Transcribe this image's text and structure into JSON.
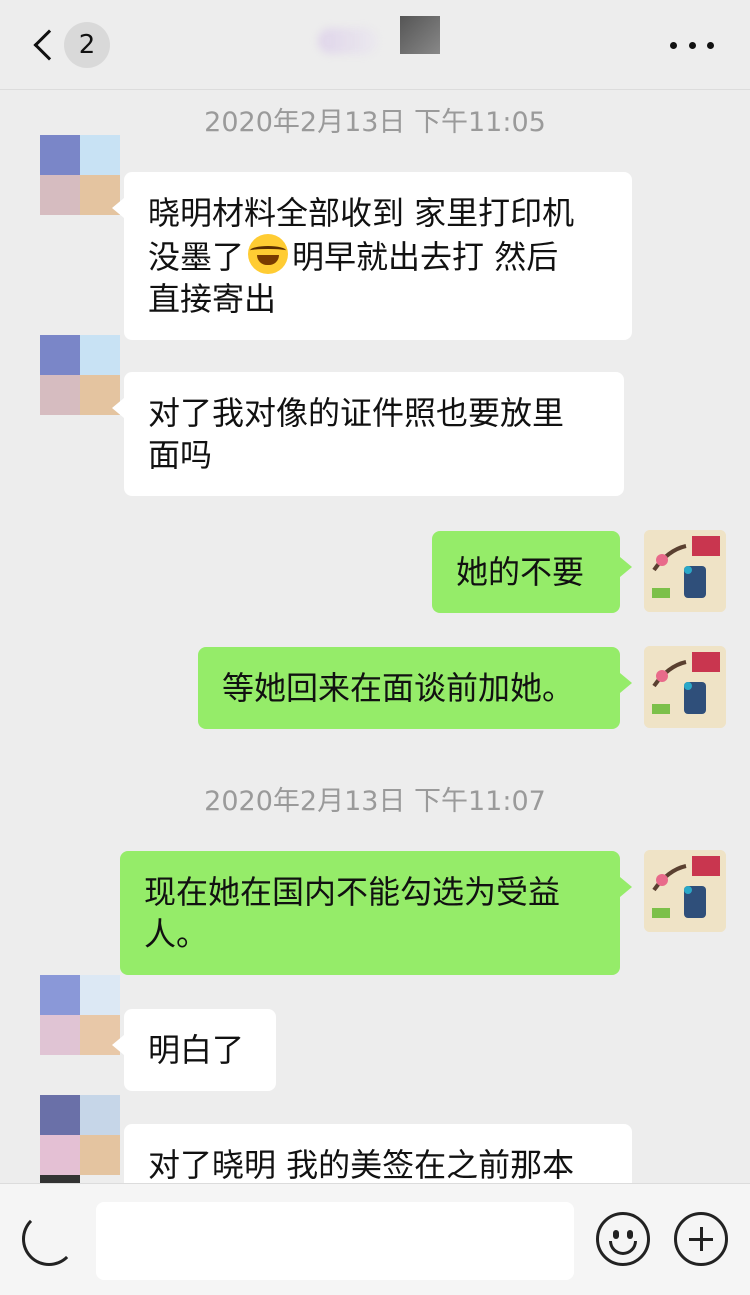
{
  "header": {
    "unread_count": "2",
    "icons": {
      "back": "chevron-left-icon",
      "more": "more-dots-icon"
    }
  },
  "timestamps": [
    "2020年2月13日 下午11:05",
    "2020年2月13日 下午11:07"
  ],
  "messages": [
    {
      "side": "in",
      "lines": [
        "晓明材料全部收到 家里打印机",
        "没墨了",
        "明早就出去打 然后",
        "直接寄出"
      ],
      "emoji": "face-with-tears-of-joy"
    },
    {
      "side": "in",
      "lines": [
        "对了我对像的证件照也要放里",
        "面吗"
      ]
    },
    {
      "side": "out",
      "lines": [
        "她的不要"
      ]
    },
    {
      "side": "out",
      "lines": [
        "等她回来在面谈前加她。"
      ]
    },
    {
      "side": "out",
      "lines": [
        "现在她在国内不能勾选为受益",
        "人。"
      ]
    },
    {
      "side": "in",
      "lines": [
        "明白了"
      ]
    },
    {
      "side": "in",
      "lines": [
        "对了晓明 我的美签在之前那本"
      ]
    }
  ],
  "input_bar": {
    "text_value": "",
    "icons": {
      "voice": "voice-icon",
      "emoji": "emoji-icon",
      "more": "plus-icon"
    }
  },
  "colors": {
    "background": "#ededed",
    "incoming_bubble": "#ffffff",
    "outgoing_bubble": "#95ec69",
    "timestamp_text": "#9a9a9a"
  }
}
